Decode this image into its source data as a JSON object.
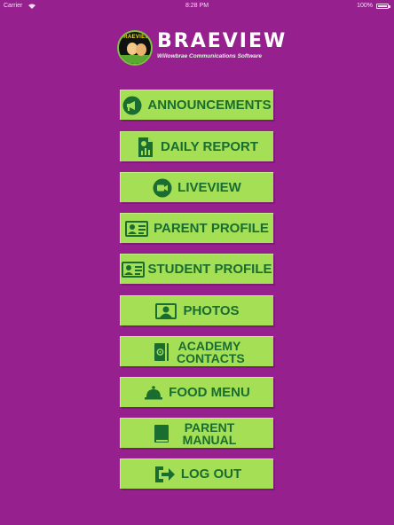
{
  "status_bar": {
    "carrier": "Carrier",
    "time": "8:28 PM",
    "battery": "100%"
  },
  "header": {
    "logo_badge_text": "BRAEVIEW",
    "title": "BRAEVIEW",
    "subtitle": "Willowbrae Communications Software"
  },
  "colors": {
    "background": "#96218e",
    "button": "#a4df56",
    "button_text": "#1a6d31"
  },
  "menu": [
    {
      "label": "ANNOUNCEMENTS",
      "icon": "megaphone-icon"
    },
    {
      "label": "DAILY REPORT",
      "icon": "report-icon"
    },
    {
      "label": "LIVEVIEW",
      "icon": "video-camera-icon"
    },
    {
      "label": "PARENT PROFILE",
      "icon": "id-card-icon"
    },
    {
      "label": "STUDENT PROFILE",
      "icon": "id-card-icon"
    },
    {
      "label": "PHOTOS",
      "icon": "photo-portrait-icon"
    },
    {
      "label": "ACADEMY CONTACTS",
      "icon": "address-book-icon"
    },
    {
      "label": "FOOD MENU",
      "icon": "food-cloche-icon"
    },
    {
      "label": "PARENT MANUAL",
      "icon": "book-icon"
    },
    {
      "label": "LOG OUT",
      "icon": "logout-icon"
    }
  ]
}
